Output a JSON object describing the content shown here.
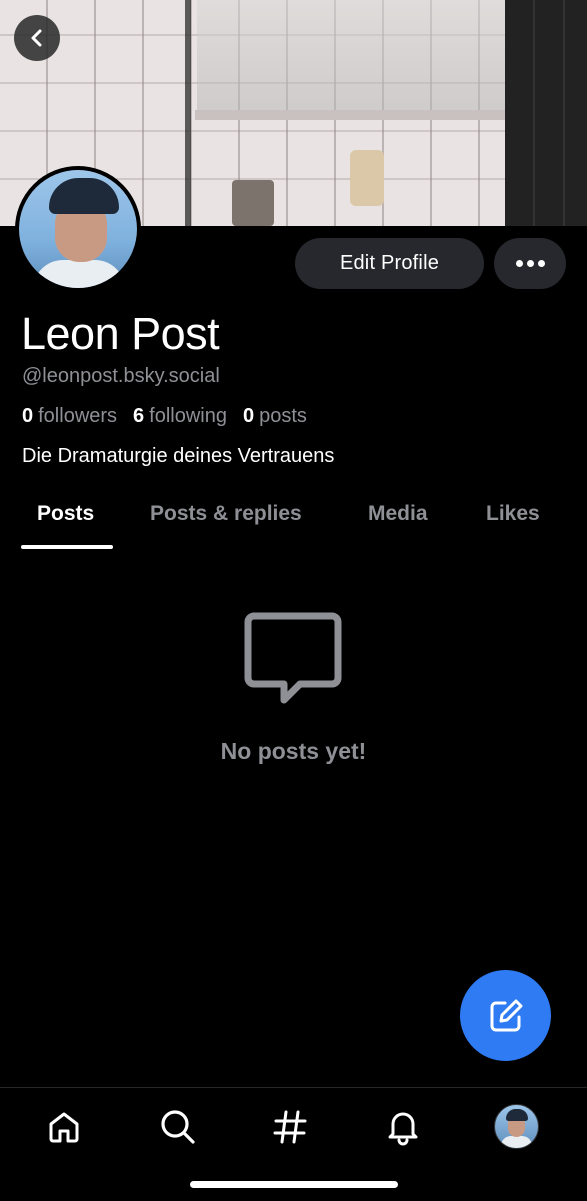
{
  "profile": {
    "name": "Leon Post",
    "handle": "@leonpost.bsky.social",
    "followers_count": "0",
    "followers_label": "followers",
    "following_count": "6",
    "following_label": "following",
    "posts_count": "0",
    "posts_label": "posts",
    "bio": "Die Dramaturgie deines Vertrauens"
  },
  "actions": {
    "edit_profile": "Edit Profile",
    "more_icon": "ellipsis-icon"
  },
  "tabs": [
    {
      "label": "Posts",
      "active": true
    },
    {
      "label": "Posts & replies",
      "active": false
    },
    {
      "label": "Media",
      "active": false
    },
    {
      "label": "Likes",
      "active": false
    }
  ],
  "empty_state": {
    "icon": "message-bubble-icon",
    "text": "No posts yet!"
  },
  "fab": {
    "icon": "compose-icon",
    "color": "#2f7bf4"
  },
  "bottom_nav": [
    "home-icon",
    "search-icon",
    "hashtag-icon",
    "notifications-bell-icon",
    "profile-avatar"
  ],
  "colors": {
    "background": "#000000",
    "muted_text": "#8e9096",
    "button_bg": "#26282d",
    "accent": "#2f7bf4"
  }
}
